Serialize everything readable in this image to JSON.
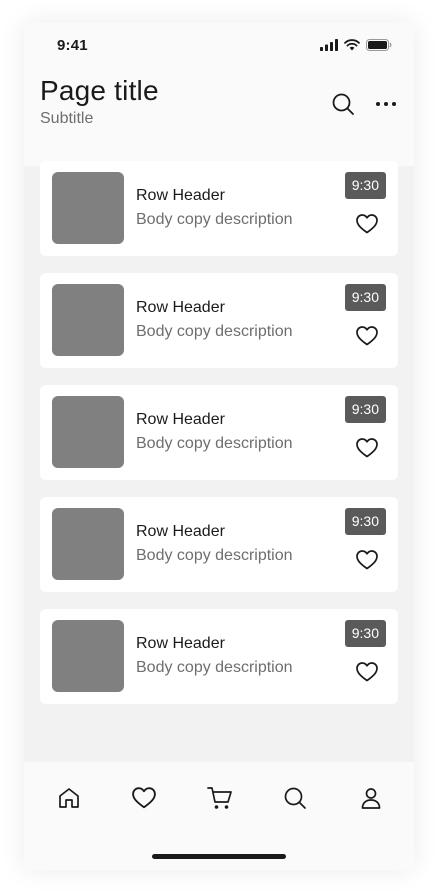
{
  "status_bar": {
    "time": "9:41",
    "icons": [
      "signal-icon",
      "wifi-icon",
      "battery-icon"
    ]
  },
  "header": {
    "title": "Page title",
    "subtitle": "Subtitle",
    "actions": [
      "search-icon",
      "more-icon"
    ]
  },
  "list": {
    "items": [
      {
        "header": "Row Header",
        "description": "Body copy description",
        "time": "9:30",
        "icon": "heart-icon"
      },
      {
        "header": "Row Header",
        "description": "Body copy description",
        "time": "9:30",
        "icon": "heart-icon"
      },
      {
        "header": "Row Header",
        "description": "Body copy description",
        "time": "9:30",
        "icon": "heart-icon"
      },
      {
        "header": "Row Header",
        "description": "Body copy description",
        "time": "9:30",
        "icon": "heart-icon"
      },
      {
        "header": "Row Header",
        "description": "Body copy description",
        "time": "9:30",
        "icon": "heart-icon"
      }
    ]
  },
  "bottom_nav": {
    "items": [
      "home-icon",
      "heart-icon",
      "cart-icon",
      "search-icon",
      "profile-icon"
    ]
  },
  "colors": {
    "background": "#f2f2f2",
    "surface": "#ffffff",
    "thumbnail": "#808080",
    "badge": "#5a5a5a",
    "text_primary": "#1a1a1a",
    "text_secondary": "#6e6e6e"
  }
}
